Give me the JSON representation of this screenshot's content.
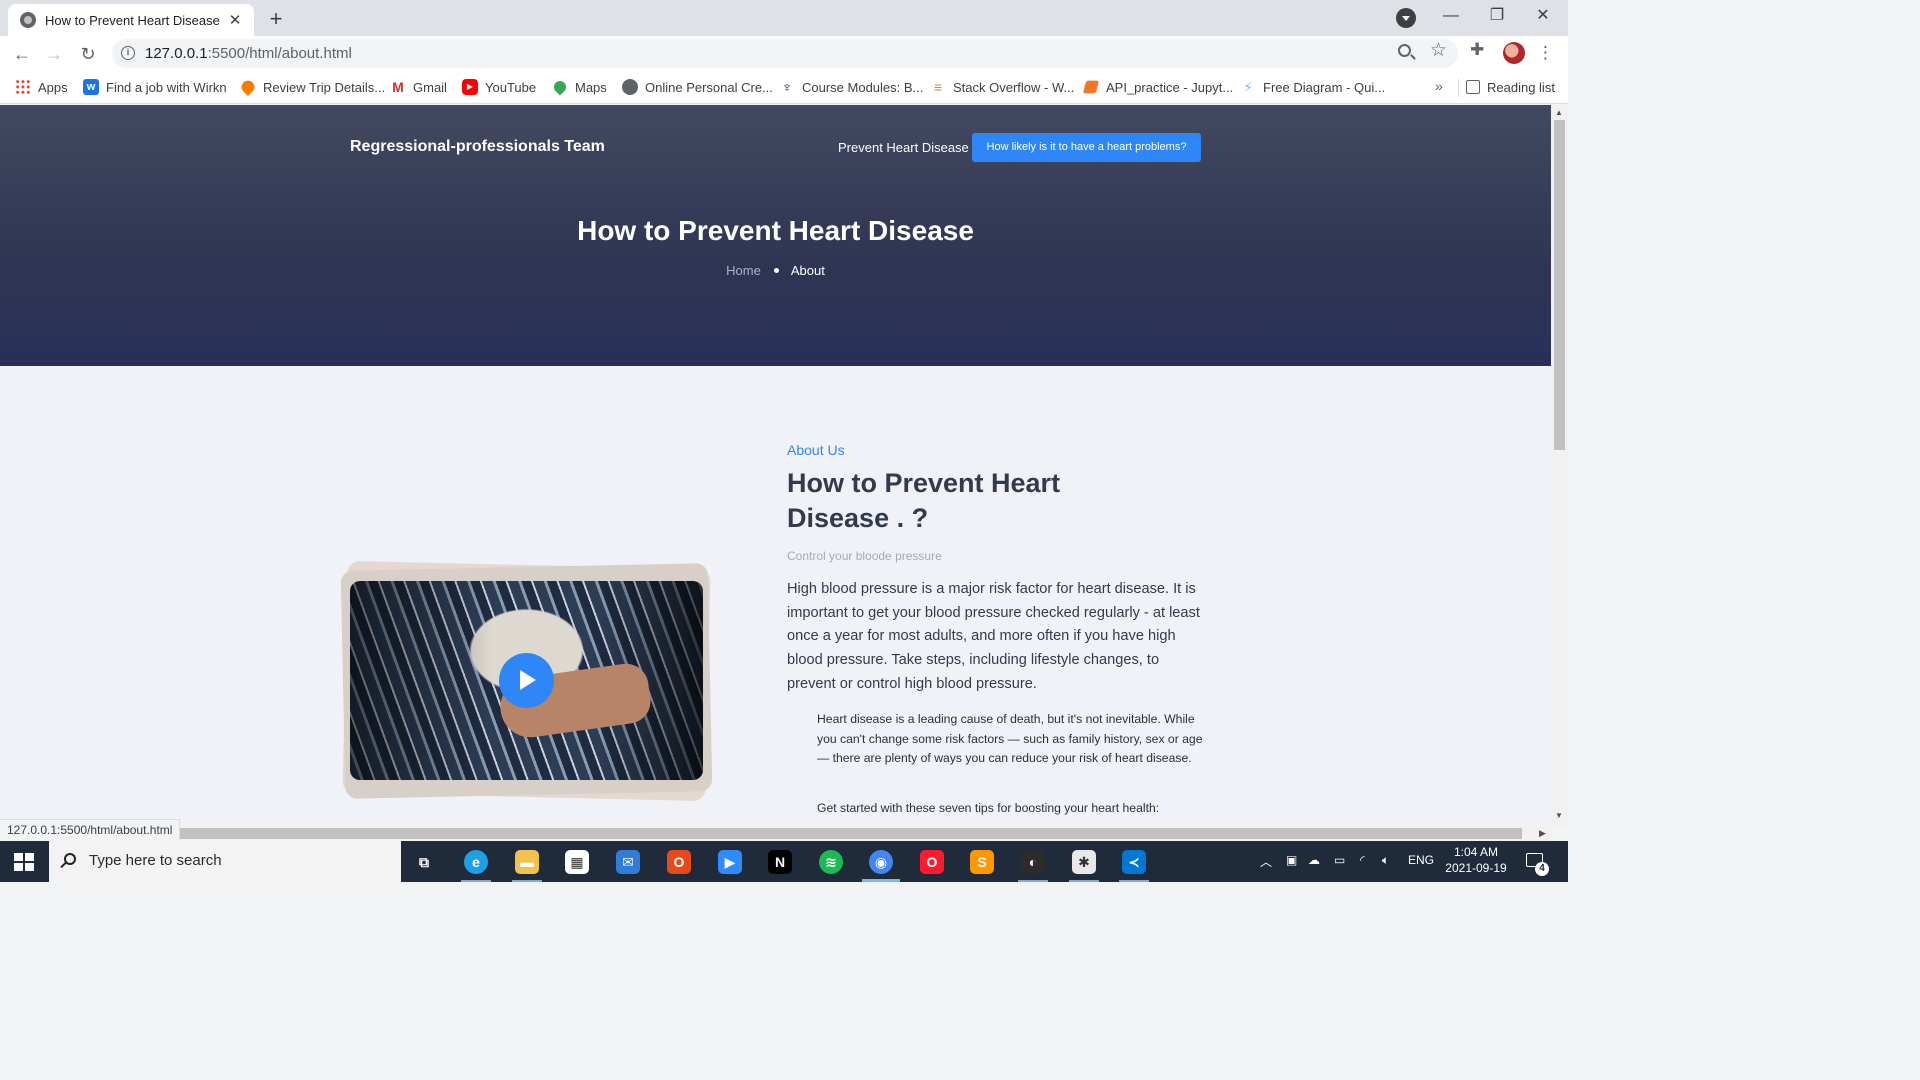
{
  "browser": {
    "tab_title": "How to Prevent Heart Disease",
    "url_host": "127.0.0.1",
    "url_rest": ":5500/html/about.html",
    "status_url": "127.0.0.1:5500/html/about.html",
    "bookmarks": [
      {
        "label": "Apps",
        "icon": "apps-icon",
        "color": "#ea4335"
      },
      {
        "label": "Find a job with Wirkn",
        "icon": "wirkn-icon",
        "color": "#1a73e8"
      },
      {
        "label": "Review Trip Details...",
        "icon": "location-pin-icon",
        "color": "#f57c00"
      },
      {
        "label": "Gmail",
        "icon": "gmail-icon",
        "color": "#d93025"
      },
      {
        "label": "YouTube",
        "icon": "youtube-icon",
        "color": "#ff0000"
      },
      {
        "label": "Maps",
        "icon": "maps-icon",
        "color": "#34a853"
      },
      {
        "label": "Online Personal Cre...",
        "icon": "globe-icon",
        "color": "#5f6368"
      },
      {
        "label": "Course Modules: B...",
        "icon": "course-icon",
        "color": "#1a3a6b"
      },
      {
        "label": "Stack Overflow - W...",
        "icon": "stackoverflow-icon",
        "color": "#f48024"
      },
      {
        "label": "API_practice - Jupyt...",
        "icon": "jupyter-icon",
        "color": "#f37626"
      },
      {
        "label": "Free Diagram - Qui...",
        "icon": "diagram-icon",
        "color": "#8ab4f8"
      }
    ],
    "reading_list": "Reading list"
  },
  "page": {
    "brand": "Regressional-professionals Team",
    "nav_link": "Prevent Heart Disease",
    "cta": "How likely is it to have a heart problems?",
    "hero_title": "How to Prevent Heart Disease",
    "breadcrumb_home": "Home",
    "breadcrumb_current": "About",
    "about_label": "About Us",
    "about_title": "How to Prevent Heart Disease . ?",
    "about_subtitle": "Control your bloode pressure",
    "about_lead": "High blood pressure is a major risk factor for heart disease. It is important to get your blood pressure checked regularly - at least once a year for most adults, and more often if you have high blood pressure. Take steps, including lifestyle changes, to prevent or control high blood pressure.",
    "about_quote": "Heart disease is a leading cause of death, but it's not inevitable. While you can't change some risk factors — such as family history, sex or age — there are plenty of ways you can reduce your risk of heart disease.",
    "about_tips": "Get started with these seven tips for boosting your heart health:",
    "accent_color": "#2f86f6"
  },
  "taskbar": {
    "search_placeholder": "Type here to search",
    "apps": [
      {
        "name": "task-view-icon",
        "color": "#ffffff",
        "glyph": "⧉"
      },
      {
        "name": "edge-icon",
        "color": "#1fa0e6",
        "glyph": "e"
      },
      {
        "name": "file-explorer-icon",
        "color": "#f2c14e",
        "glyph": "▬"
      },
      {
        "name": "store-icon",
        "color": "#ffffff",
        "glyph": "▦"
      },
      {
        "name": "mail-icon",
        "color": "#2f7dd8",
        "glyph": "✉"
      },
      {
        "name": "office-icon",
        "color": "#e64a19",
        "glyph": "O"
      },
      {
        "name": "zoom-icon",
        "color": "#2d8cff",
        "glyph": "▶"
      },
      {
        "name": "netflix-icon",
        "color": "#000000",
        "glyph": "N"
      },
      {
        "name": "spotify-icon",
        "color": "#1db954",
        "glyph": "≋"
      },
      {
        "name": "chrome-icon",
        "color": "#4285f4",
        "glyph": "◉"
      },
      {
        "name": "opera-icon",
        "color": "#ff1b2d",
        "glyph": "O"
      },
      {
        "name": "sublime-icon",
        "color": "#ff9800",
        "glyph": "S"
      },
      {
        "name": "alienware-icon",
        "color": "#2b2b2b",
        "glyph": "◐"
      },
      {
        "name": "slack-icon",
        "color": "#e8e8e8",
        "glyph": "✱"
      },
      {
        "name": "vscode-icon",
        "color": "#0078d4",
        "glyph": "≺"
      }
    ],
    "language": "ENG",
    "time": "1:04 AM",
    "date": "2021-09-19",
    "notification_count": "4"
  }
}
